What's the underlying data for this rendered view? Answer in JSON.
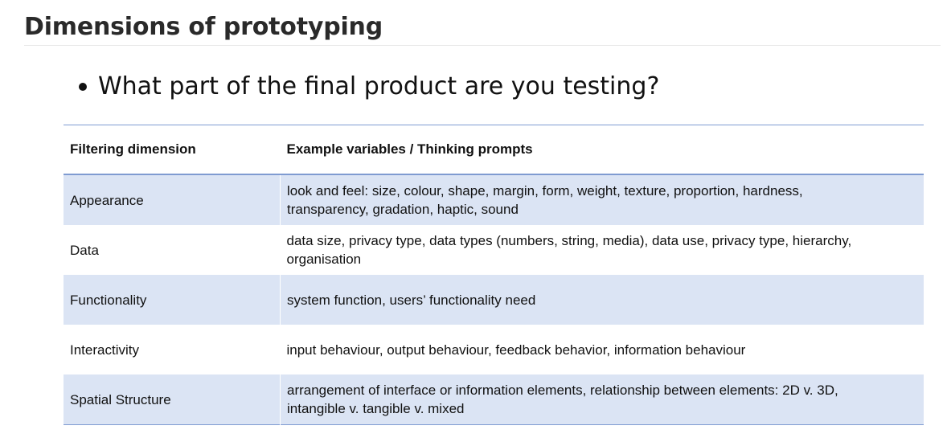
{
  "page": {
    "heading": "Dimensions of prototyping",
    "bullet": "What part of the final product are you testing?"
  },
  "table": {
    "headers": [
      "Filtering dimension",
      "Example variables / Thinking prompts"
    ],
    "rows": [
      {
        "dimension": "Appearance",
        "variables_line1": "look and feel: size, colour, shape, margin, form, weight, texture, proportion, hardness,",
        "variables_line2": "transparency, gradation, haptic, sound"
      },
      {
        "dimension": "Data",
        "variables_line1": "data size, privacy type, data types (numbers, string, media), data use, privacy type, hierarchy,",
        "variables_line2": "organisation"
      },
      {
        "dimension": "Functionality",
        "variables_line1": "system function, users’ functionality need",
        "variables_line2": ""
      },
      {
        "dimension": "Interactivity",
        "variables_line1": "input behaviour, output behaviour, feedback behavior, information behaviour",
        "variables_line2": ""
      },
      {
        "dimension": "Spatial Structure",
        "variables_line1": "arrangement of interface or information elements, relationship between elements: 2D v. 3D,",
        "variables_line2": "intangible v. tangible v. mixed"
      }
    ]
  },
  "colors": {
    "row_shade": "#dbe4f4",
    "rule": "#7f9bd1"
  }
}
